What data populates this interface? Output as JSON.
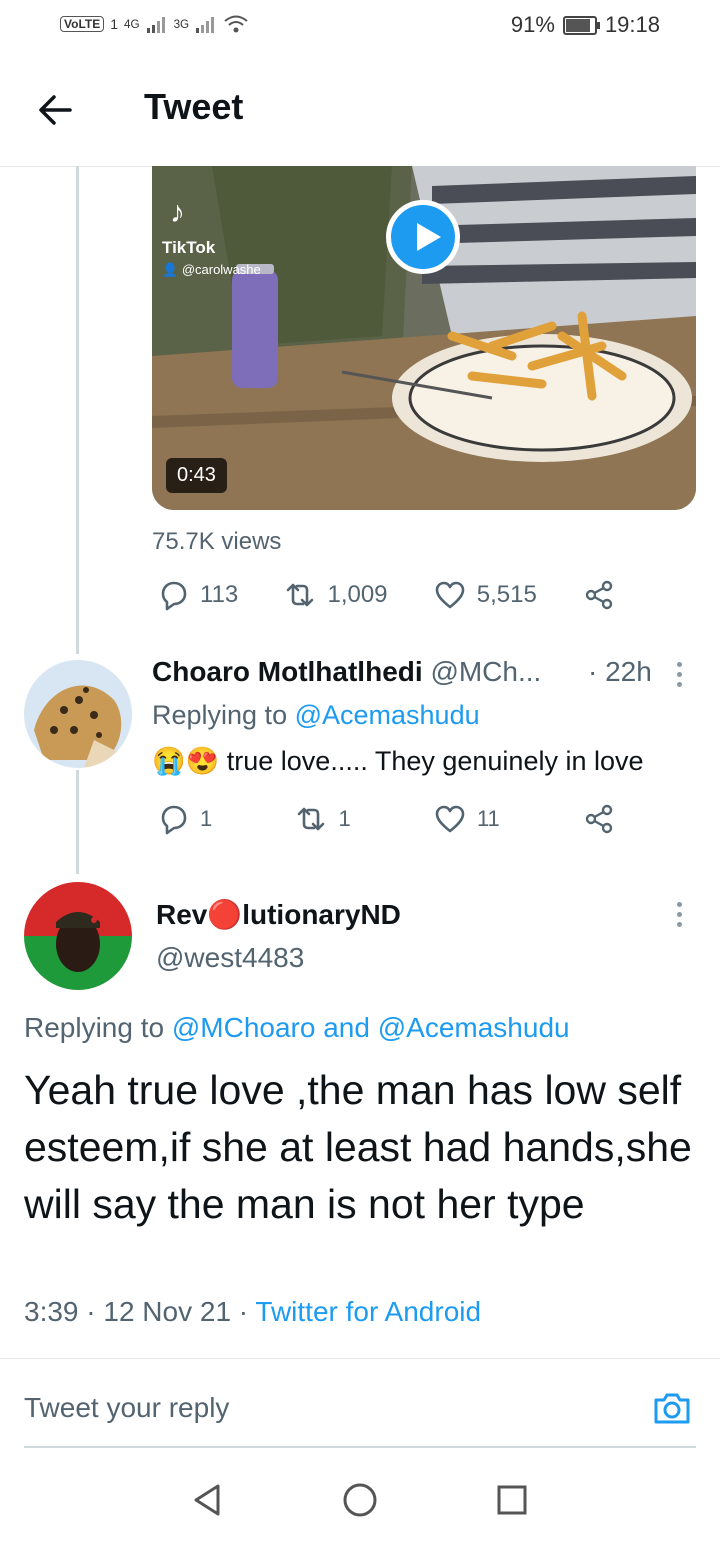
{
  "status_bar": {
    "volte": "VoLTE",
    "sim": "1",
    "net1": "4G",
    "net2": "3G",
    "battery": "91%",
    "battery_level": 0.91,
    "time": "19:18"
  },
  "header": {
    "title": "Tweet"
  },
  "video": {
    "platform": "TikTok",
    "handle": "@carolwashe",
    "duration": "0:43",
    "views": "75.7K views"
  },
  "main_tweet_actions": {
    "replies": "113",
    "retweets": "1,009",
    "likes": "5,515"
  },
  "reply1": {
    "name": "Choaro Motlhatlhedi",
    "handle": "@MCh...",
    "time": "· 22h",
    "replying_prefix": "Replying to ",
    "replying_to": "@Acemashudu",
    "emojis": "😭😍",
    "text": "true love..... They genuinely in love",
    "replies": "1",
    "retweets": "1",
    "likes": "11"
  },
  "reply2": {
    "name": "Rev🔴lutionaryND",
    "handle": "@west4483",
    "replying_prefix": "Replying to ",
    "replying_to": "@MChoaro and @Acemashudu",
    "text": "Yeah true love ,the man has low self esteem,if she at least had hands,she will say the man is not her type",
    "meta": "3:39 · 12 Nov 21 · ",
    "source": "Twitter for Android"
  },
  "reply_box": {
    "placeholder": "Tweet your reply"
  },
  "icons": {
    "back": "arrow-left-icon",
    "reply": "speech-bubble-icon",
    "retweet": "retweet-icon",
    "like": "heart-icon",
    "share": "share-icon",
    "camera": "camera-icon"
  }
}
